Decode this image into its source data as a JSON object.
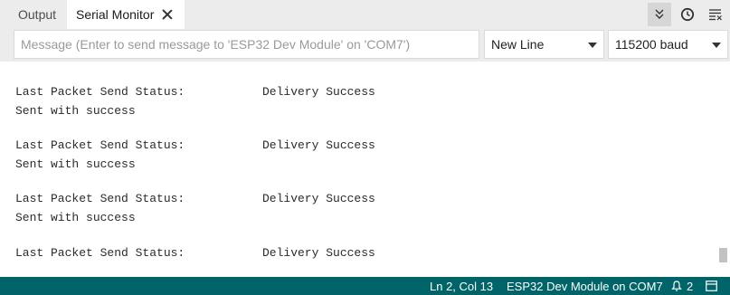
{
  "tabs": [
    {
      "label": "Output"
    },
    {
      "label": "Serial Monitor"
    }
  ],
  "toolbar": {
    "autoscroll_icon": "chevrons-down-icon",
    "timestamp_icon": "clock-icon",
    "clear_icon": "clear-output-icon"
  },
  "controls": {
    "message_placeholder": "Message (Enter to send message to 'ESP32 Dev Module' on 'COM7')",
    "line_ending": "New Line",
    "baud_rate": "115200 baud"
  },
  "output": {
    "lines": [
      {
        "label": "Last Packet Send Status:",
        "value": "Delivery Success"
      },
      {
        "text": "Sent with success"
      },
      {
        "label": "Last Packet Send Status:",
        "value": "Delivery Success"
      },
      {
        "text": "Sent with success"
      },
      {
        "label": "Last Packet Send Status:",
        "value": "Delivery Success"
      },
      {
        "text": "Sent with success"
      },
      {
        "label": "Last Packet Send Status:",
        "value": "Delivery Success"
      }
    ]
  },
  "statusbar": {
    "position": "Ln 2, Col 13",
    "board": "ESP32 Dev Module on COM7",
    "notifications": "2",
    "background": "#006468"
  },
  "colors": {
    "accent": "#006468",
    "tab_bar": "#ececec",
    "text": "#2b2b2b"
  }
}
